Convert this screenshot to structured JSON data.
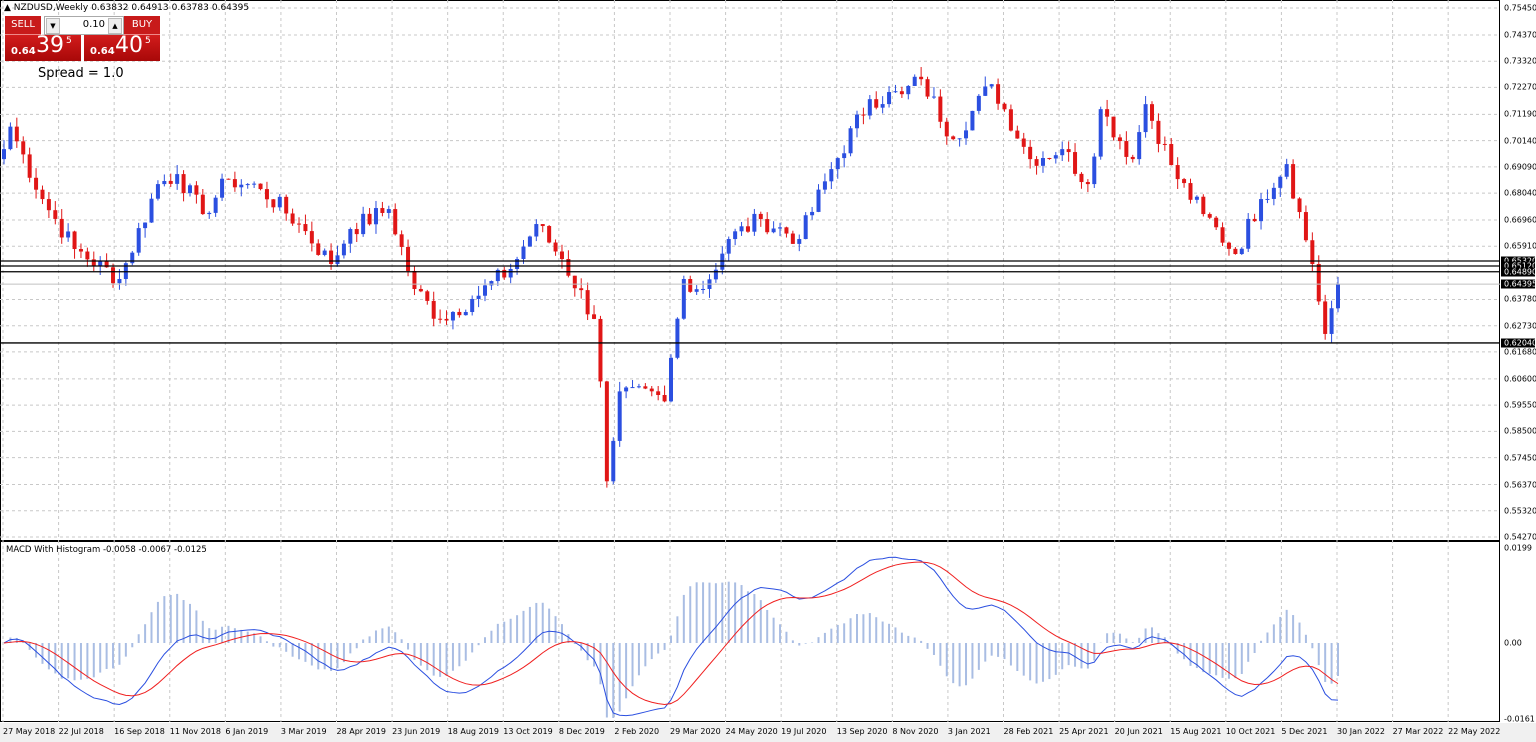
{
  "header": {
    "symbol": "NZDUSD,Weekly",
    "open": "0.63832",
    "high": "0.64913",
    "low": "0.63783",
    "close": "0.64395"
  },
  "trade_panel": {
    "sell_label": "SELL",
    "buy_label": "BUY",
    "lot": "0.10",
    "sell_prefix": "0.64",
    "sell_big": "39",
    "sell_pip": "5",
    "buy_prefix": "0.64",
    "buy_big": "40",
    "buy_pip": "5",
    "spread": "Spread = 1.0"
  },
  "price_axis": {
    "ticks": [
      "0.75450",
      "0.74370",
      "0.73320",
      "0.72270",
      "0.71190",
      "0.70140",
      "0.69090",
      "0.68040",
      "0.66960",
      "0.65910",
      "0.63780",
      "0.62730",
      "0.61680",
      "0.60600",
      "0.59550",
      "0.58500",
      "0.57450",
      "0.56370",
      "0.55320",
      "0.54270"
    ],
    "highlighted": [
      "0.65320",
      "0.65120",
      "0.64890",
      "0.64395",
      "0.62040"
    ]
  },
  "macd": {
    "label": "MACD With Histogram -0.0058 -0.0067 -0.0125",
    "ticks": [
      "0.0199",
      "0.00",
      "-0.0161"
    ]
  },
  "time_axis": [
    "27 May 2018",
    "22 Jul 2018",
    "16 Sep 2018",
    "11 Nov 2018",
    "6 Jan 2019",
    "3 Mar 2019",
    "28 Apr 2019",
    "23 Jun 2019",
    "18 Aug 2019",
    "13 Oct 2019",
    "8 Dec 2019",
    "2 Feb 2020",
    "29 Mar 2020",
    "24 May 2020",
    "19 Jul 2020",
    "13 Sep 2020",
    "8 Nov 2020",
    "3 Jan 2021",
    "28 Feb 2021",
    "25 Apr 2021",
    "20 Jun 2021",
    "15 Aug 2021",
    "10 Oct 2021",
    "5 Dec 2021",
    "30 Jan 2022",
    "27 Mar 2022",
    "22 May 2022"
  ],
  "colors": {
    "bull": "#2b4fe0",
    "bear": "#e01616",
    "macd": "#2b4fe0",
    "signal": "#f02020",
    "hist": "#a9bde3"
  },
  "chart_data": {
    "type": "candlestick",
    "bars": 209,
    "price_range": [
      0.5427,
      0.7545
    ],
    "close_keypoints": [
      [
        0,
        0.698
      ],
      [
        1,
        0.707
      ],
      [
        6,
        0.678
      ],
      [
        11,
        0.658
      ],
      [
        18,
        0.646
      ],
      [
        24,
        0.684
      ],
      [
        27,
        0.688
      ],
      [
        31,
        0.672
      ],
      [
        35,
        0.686
      ],
      [
        40,
        0.682
      ],
      [
        46,
        0.668
      ],
      [
        51,
        0.652
      ],
      [
        54,
        0.666
      ],
      [
        60,
        0.674
      ],
      [
        64,
        0.642
      ],
      [
        68,
        0.63
      ],
      [
        73,
        0.638
      ],
      [
        79,
        0.65
      ],
      [
        83,
        0.668
      ],
      [
        87,
        0.654
      ],
      [
        92,
        0.63
      ],
      [
        93,
        0.605
      ],
      [
        94,
        0.565
      ],
      [
        96,
        0.601
      ],
      [
        103,
        0.597
      ],
      [
        106,
        0.646
      ],
      [
        109,
        0.642
      ],
      [
        113,
        0.662
      ],
      [
        118,
        0.67
      ],
      [
        124,
        0.662
      ],
      [
        129,
        0.69
      ],
      [
        135,
        0.718
      ],
      [
        140,
        0.72
      ],
      [
        143,
        0.726
      ],
      [
        148,
        0.702
      ],
      [
        154,
        0.724
      ],
      [
        160,
        0.694
      ],
      [
        165,
        0.698
      ],
      [
        169,
        0.684
      ],
      [
        171,
        0.714
      ],
      [
        176,
        0.694
      ],
      [
        178,
        0.716
      ],
      [
        183,
        0.686
      ],
      [
        187,
        0.672
      ],
      [
        192,
        0.656
      ],
      [
        196,
        0.678
      ],
      [
        200,
        0.692
      ],
      [
        204,
        0.652
      ],
      [
        206,
        0.624
      ],
      [
        208,
        0.64395
      ]
    ],
    "hlines": [
      0.6532,
      0.6512,
      0.6489,
      0.6204
    ],
    "current": 0.64395
  }
}
